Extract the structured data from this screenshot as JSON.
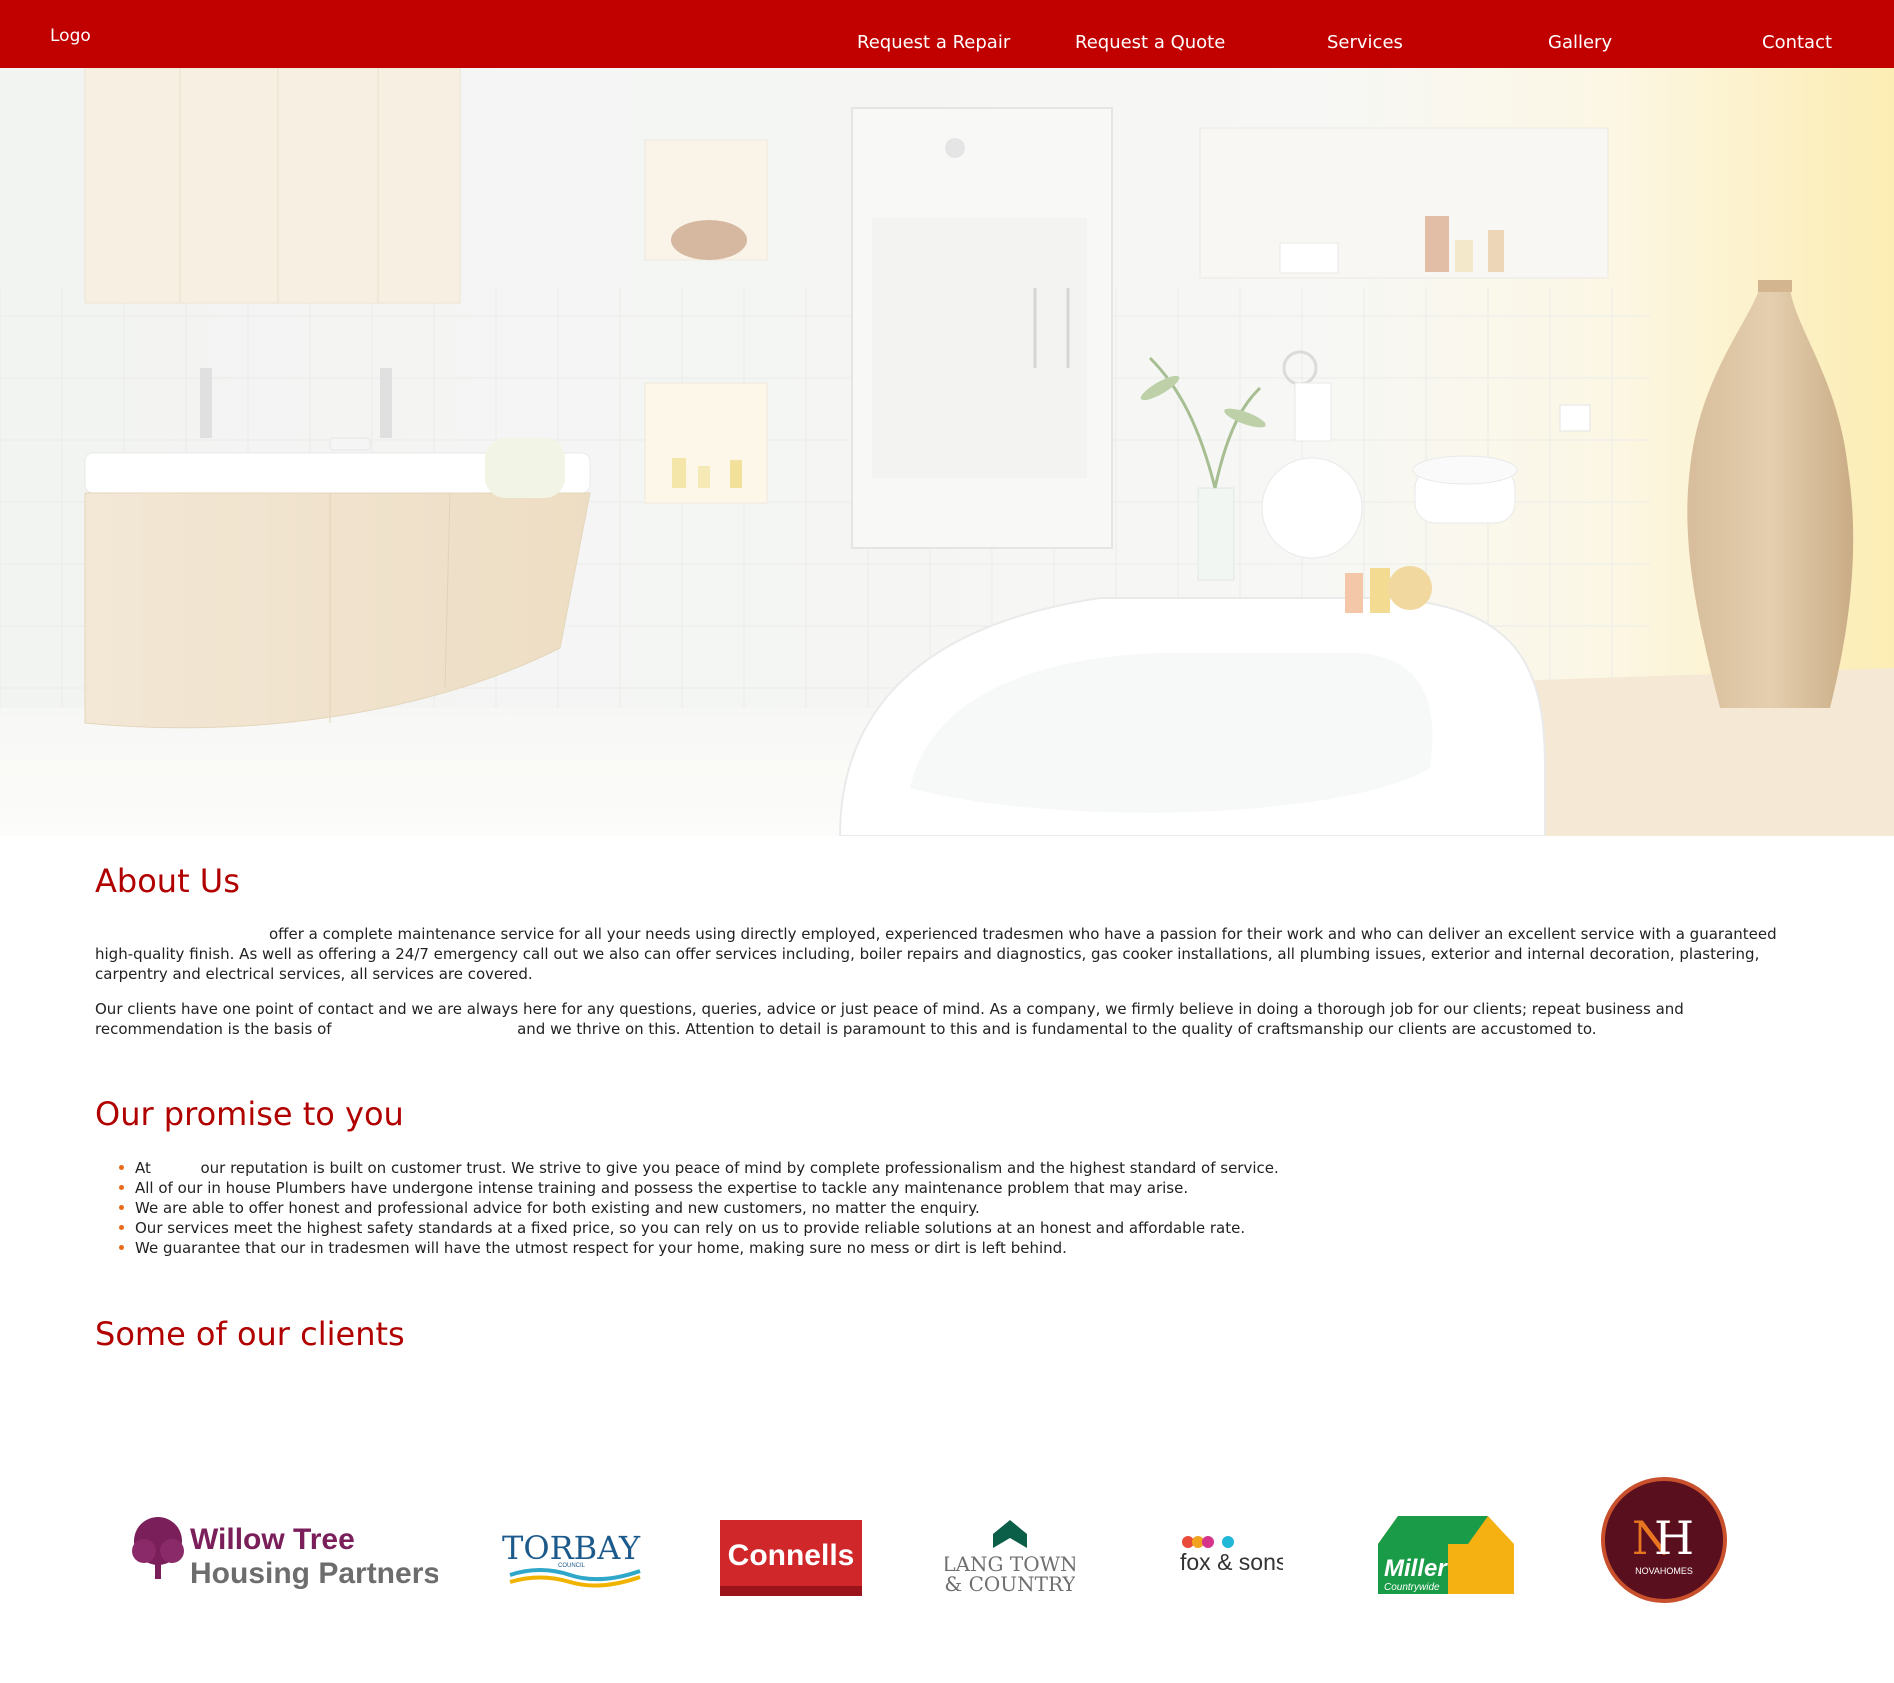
{
  "header": {
    "logo": "Logo",
    "nav": [
      "Request a Repair",
      "Request a Quote",
      "Services",
      "Gallery",
      "Contact"
    ]
  },
  "about": {
    "heading": "About Us",
    "p1_text": "offer a complete maintenance service for all your needs using directly employed, experienced tradesmen who have a passion for their work and who can deliver an excellent service with a guaranteed high-quality finish. As well as offering a 24/7 emergency call out we also can offer services including, boiler repairs and diagnostics, gas cooker installations, all plumbing issues, exterior and internal decoration, plastering, carpentry and electrical services, all services are covered.",
    "p2_start": "Our clients have one point of contact and we are always here for any questions, queries, advice or just peace of mind. As a company, we firmly believe in doing a thorough job for our clients; repeat business and recommendation is the basis of",
    "p2_end": "and we thrive on this. Attention to detail is paramount to this and is fundamental to the quality of craftsmanship our clients are accustomed to."
  },
  "promise": {
    "heading": "Our promise to you",
    "item1_start": "At",
    "item1_end": "our reputation is built on customer trust. We strive to give you peace of mind by complete professionalism and the highest standard of service.",
    "items": [
      "All of our in house Plumbers have undergone intense training and possess the expertise to tackle any maintenance problem that may arise.",
      "We are able to offer honest and professional advice for both existing and new customers, no matter the enquiry.",
      "Our services meet the highest safety standards at a fixed price, so you can rely on us to provide reliable solutions at an honest and affordable rate.",
      "We guarantee that our in tradesmen will have the utmost respect for your home, making sure no mess or dirt is left behind."
    ]
  },
  "clients": {
    "heading": "Some of our clients",
    "willow_line1": "Willow Tree",
    "willow_line2": "Housing Partnership",
    "torbay": "TORBAY",
    "torbay_sub": "COUNCIL",
    "connells": "Connells",
    "lang_line1": "LANG TOWN",
    "lang_line2": "& COUNTRY",
    "fox": "fox & sons",
    "miller": "Miller",
    "miller_sub": "Countrywide",
    "nova": "NOVAHOMES"
  },
  "colors": {
    "header_red": "#c10000",
    "heading_red": "#b10000",
    "bullet_orange": "#e86a18"
  }
}
